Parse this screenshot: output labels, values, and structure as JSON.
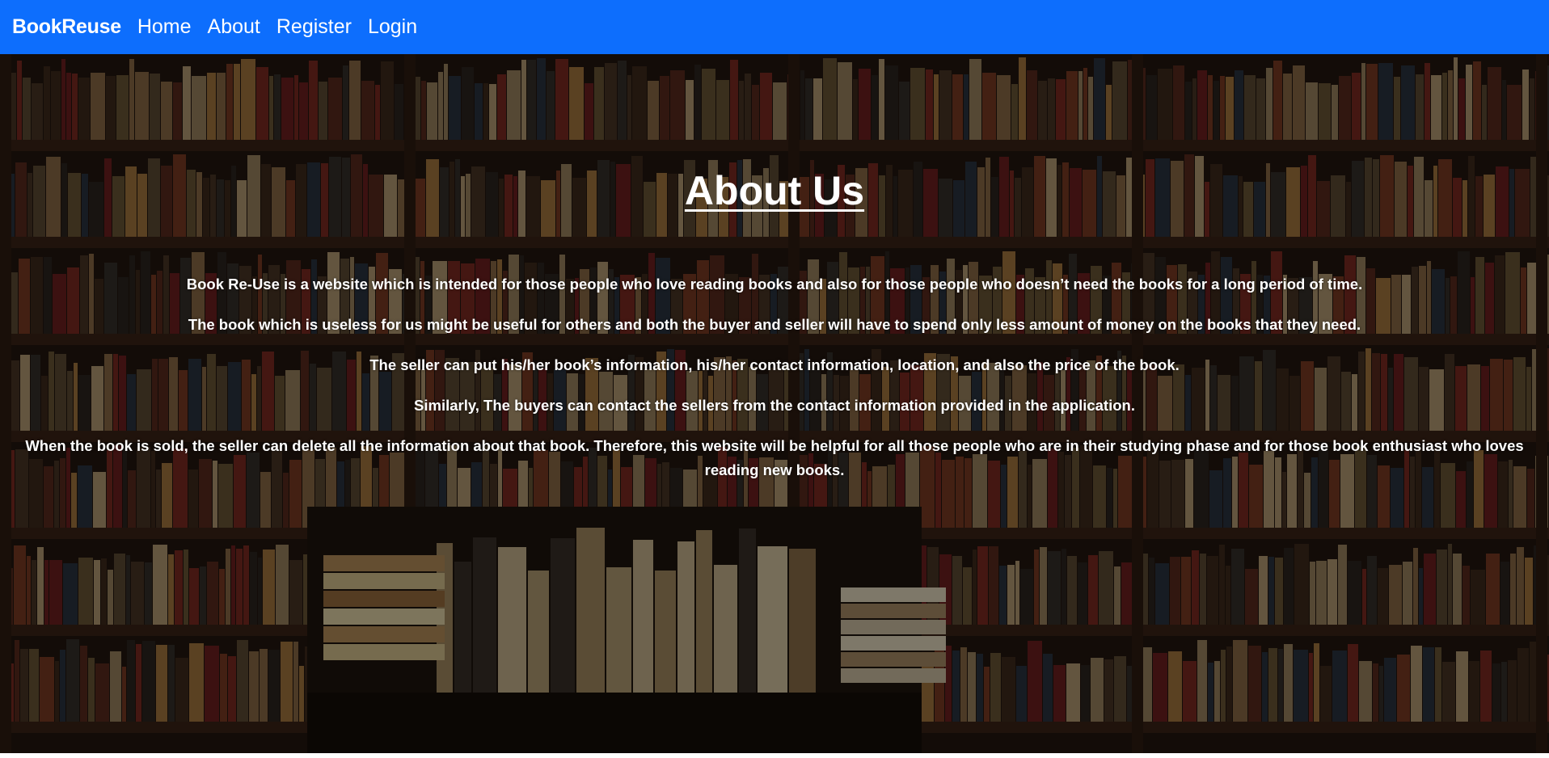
{
  "navbar": {
    "brand": "BookReuse",
    "links": [
      {
        "label": "Home"
      },
      {
        "label": "About"
      },
      {
        "label": "Register"
      },
      {
        "label": "Login"
      }
    ],
    "color": "#0d6efd"
  },
  "about": {
    "title": "About Us",
    "paragraphs": [
      "Book Re-Use is a website which is intended for those people who love reading books and also for those people who doesn’t need the books for a long period of time.",
      "The book which is useless for us might be useful for others and both the buyer and seller will have to spend only less amount of money on the books that they need.",
      "The seller can put his/her book’s information, his/her contact information, location, and also the price of the book.",
      "Similarly, The buyers can contact the sellers from the contact information provided in the application.",
      "When the book is sold, the seller can delete all the information about that book. Therefore, this website will be helpful for all those people who are in their studying phase and for those book enthusiast who loves reading new books."
    ]
  },
  "background": {
    "image": "library-bookshelves-photo"
  }
}
